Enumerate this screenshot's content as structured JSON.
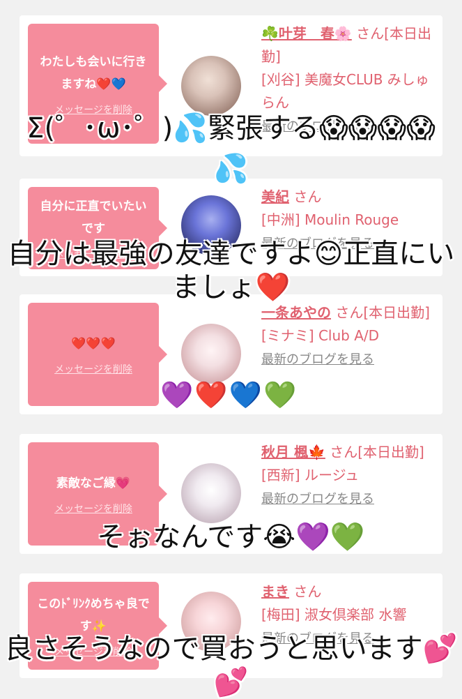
{
  "cards": [
    {
      "bubble_message": "わたしも会いに行きますね❤️💙",
      "delete_label": "メッセージを削除",
      "name": "☘️叶芽　春🌸",
      "suffix": "さん[本日出勤]",
      "shop": "[刈谷] 美魔女CLUB みしゅらん",
      "blog": "最新のブログを見る",
      "avatar_colors": [
        "#d9c2b8",
        "#7c5a4e"
      ]
    },
    {
      "bubble_message": "自分に正直でいたいです",
      "delete_label": "メッセージを削除",
      "name": "美紀",
      "suffix": "さん",
      "shop": "[中洲] Moulin Rouge",
      "blog": "最新のブログを見る",
      "avatar_colors": [
        "#6a74d8",
        "#1a1c4a"
      ]
    },
    {
      "bubble_message": "❤️❤️❤️",
      "delete_label": "メッセージを削除",
      "name": "一条あやの",
      "suffix": "さん[本日出勤]",
      "shop": "[ミナミ] Club A/D",
      "blog": "最新のブログを見る",
      "avatar_colors": [
        "#f3dfe2",
        "#c28a8e"
      ]
    },
    {
      "bubble_message": "素敵なご縁💗",
      "delete_label": "メッセージを削除",
      "name": "秋月 楓🍁",
      "suffix": "さん[本日出勤]",
      "shop": "[西新] ルージュ",
      "blog": "最新のブログを見る",
      "avatar_colors": [
        "#f0eaf0",
        "#b29aa8"
      ]
    },
    {
      "bubble_message": "このﾄﾞﾘﾝｸめちゃ良です✨",
      "delete_label": "メッセージを削除",
      "name": "まき",
      "suffix": "さん",
      "shop": "[梅田] 淑女倶楽部 水響",
      "blog": "最新のブログを見る",
      "avatar_colors": [
        "#f7d5d8",
        "#c79494"
      ]
    }
  ],
  "overlays": {
    "caption1": "Σ(゜･ω･゜)💦緊張する😱😱😱😱",
    "caption1b": "💦",
    "caption2": "自分は最強の友達ですよ😊正直にいましょ❤️",
    "emoji_row3": "💜❤️💙💚",
    "caption3": "そぉなんです😭💜💚",
    "caption4": "良さそうなので買おうと思います💕💕"
  }
}
